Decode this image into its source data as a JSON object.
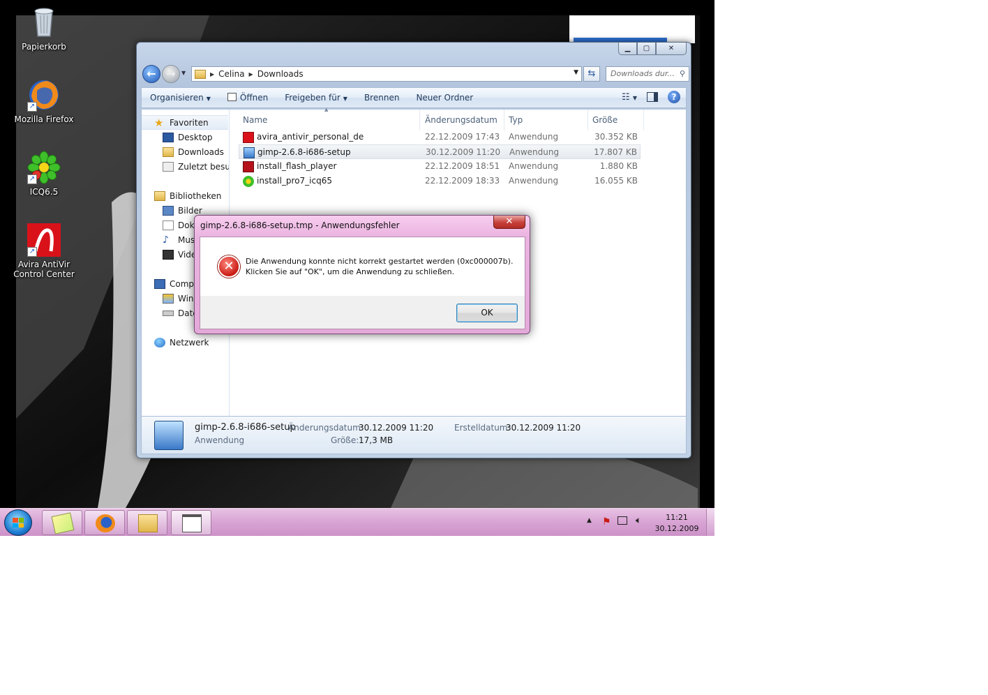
{
  "desktop": {
    "icons": [
      {
        "label": "Papierkorb",
        "icon": "recycle-bin-icon"
      },
      {
        "label": "Mozilla Firefox",
        "icon": "firefox-icon"
      },
      {
        "label": "ICQ6.5",
        "icon": "icq-flower-icon"
      },
      {
        "label": "Avira AntiVir Control Center",
        "icon": "avira-umbrella-icon"
      }
    ]
  },
  "explorer": {
    "address": {
      "crumbs": [
        "Celina",
        "Downloads"
      ]
    },
    "search": {
      "placeholder": "Downloads dur..."
    },
    "toolbar": {
      "organize": "Organisieren",
      "open": "Öffnen",
      "share": "Freigeben für",
      "burn": "Brennen",
      "new_folder": "Neuer Ordner"
    },
    "nav": {
      "favorites": "Favoriten",
      "desktop": "Desktop",
      "downloads": "Downloads",
      "recent": "Zuletzt besucht",
      "libraries": "Bibliotheken",
      "pictures": "Bilder",
      "documents": "Dokumente",
      "music": "Musik",
      "videos": "Videos",
      "computer": "Computer",
      "windows_drive": "Windows",
      "data_drive": "Daten",
      "network": "Netzwerk"
    },
    "columns": {
      "name": "Name",
      "date": "Änderungsdatum",
      "type": "Typ",
      "size": "Größe"
    },
    "files": [
      {
        "name": "avira_antivir_personal_de",
        "date": "22.12.2009 17:43",
        "type": "Anwendung",
        "size": "30.352 KB"
      },
      {
        "name": "gimp-2.6.8-i686-setup",
        "date": "30.12.2009 11:20",
        "type": "Anwendung",
        "size": "17.807 KB"
      },
      {
        "name": "install_flash_player",
        "date": "22.12.2009 18:51",
        "type": "Anwendung",
        "size": "1.880 KB"
      },
      {
        "name": "install_pro7_icq65",
        "date": "22.12.2009 18:33",
        "type": "Anwendung",
        "size": "16.055 KB"
      }
    ],
    "details": {
      "name": "gimp-2.6.8-i686-setup",
      "type": "Anwendung",
      "modified_label": "Änderungsdatum:",
      "modified_value": "30.12.2009 11:20",
      "size_label": "Größe:",
      "size_value": "17,3 MB",
      "created_label": "Erstelldatum:",
      "created_value": "30.12.2009 11:20"
    }
  },
  "dialog": {
    "title": "gimp-2.6.8-i686-setup.tmp - Anwendungsfehler",
    "message_line1": "Die Anwendung konnte nicht korrekt gestartet werden (0xc000007b).",
    "message_line2": "Klicken Sie auf \"OK\", um die Anwendung zu schließen.",
    "ok_label": "OK"
  },
  "taskbar": {
    "clock_time": "11:21",
    "clock_date": "30.12.2009"
  },
  "colors": {
    "dialog_frame": "#e8b2de",
    "taskbar": "#d9a6d5",
    "explorer_frame": "#b4c6de",
    "error_red": "#c91a12"
  }
}
